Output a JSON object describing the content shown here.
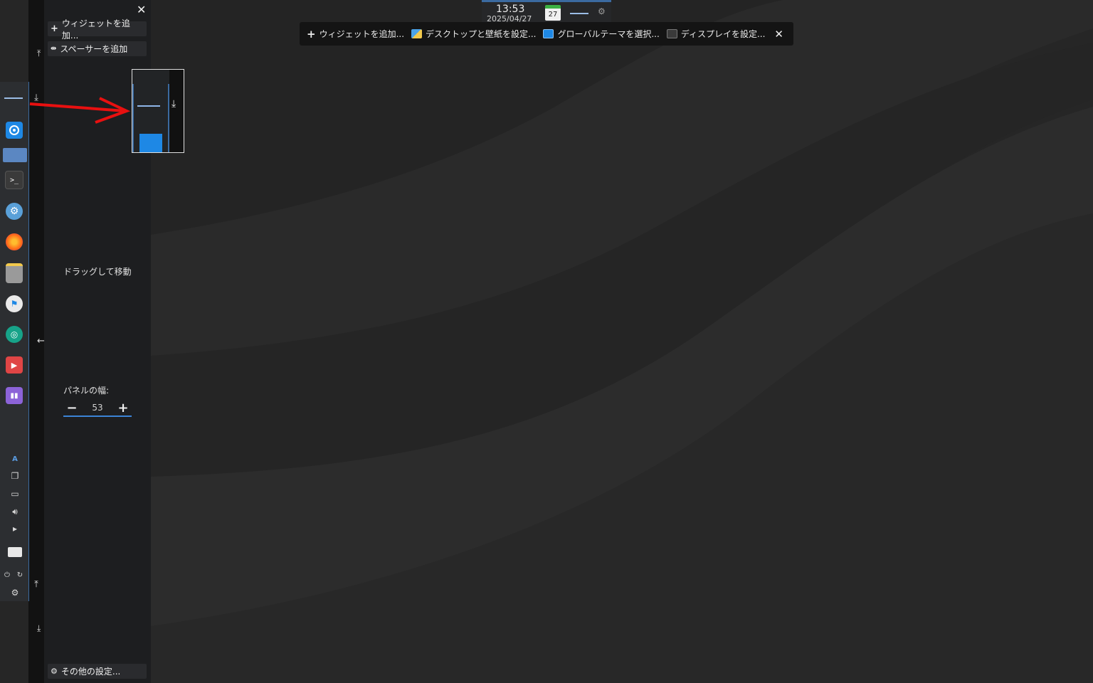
{
  "clock": {
    "time": "13:53",
    "date": "2025/04/27",
    "calendar_day": "27"
  },
  "toolbar": {
    "add_widgets": "ウィジェットを追加...",
    "desktop_wallpaper": "デスクトップと壁紙を設定...",
    "global_theme": "グローバルテーマを選択...",
    "display": "ディスプレイを設定..."
  },
  "settings_panel": {
    "add_widgets": "ウィジェットを追加...",
    "add_spacer": "スペーサーを追加",
    "drag_to_move": "ドラッグして移動",
    "panel_width_label": "パネルの幅:",
    "panel_width_value": "53",
    "more_settings": "その他の設定..."
  },
  "tray": {
    "keyboard_layout": "A"
  },
  "colors": {
    "accent": "#3b84d6",
    "annotation_arrow": "#e81010",
    "panel_bg": "#2c2e31"
  },
  "icons": [
    "plus-icon",
    "close-icon",
    "spacer-icon",
    "gear-icon",
    "terminal-icon",
    "firefox-icon",
    "globe-icon",
    "files-icon",
    "calendar-icon"
  ]
}
